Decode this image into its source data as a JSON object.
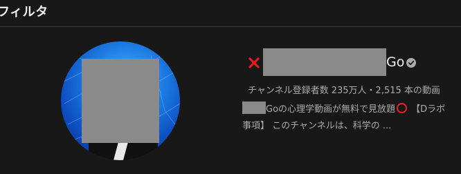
{
  "filter": {
    "label": "フィルタ"
  },
  "channel": {
    "name_tail": "Go",
    "stats": "チャンネル登録者数 235万人・2,515 本の動画",
    "description_line1_a": "Goの心理学動画が無料で見放題",
    "description_line1_b": "【Dラボ",
    "description_line2": "事項】 このチャンネルは、科学の ..."
  },
  "colors": {
    "background": "#181818",
    "text_primary": "#f1f1f1",
    "text_secondary": "#aaaaaa",
    "redaction": "#8a8a8a",
    "x_mark": "#e21d1d",
    "circle_mark": "#e22222"
  },
  "icons": {
    "x_mark": "red-x-icon",
    "verified": "verified-check-icon"
  }
}
